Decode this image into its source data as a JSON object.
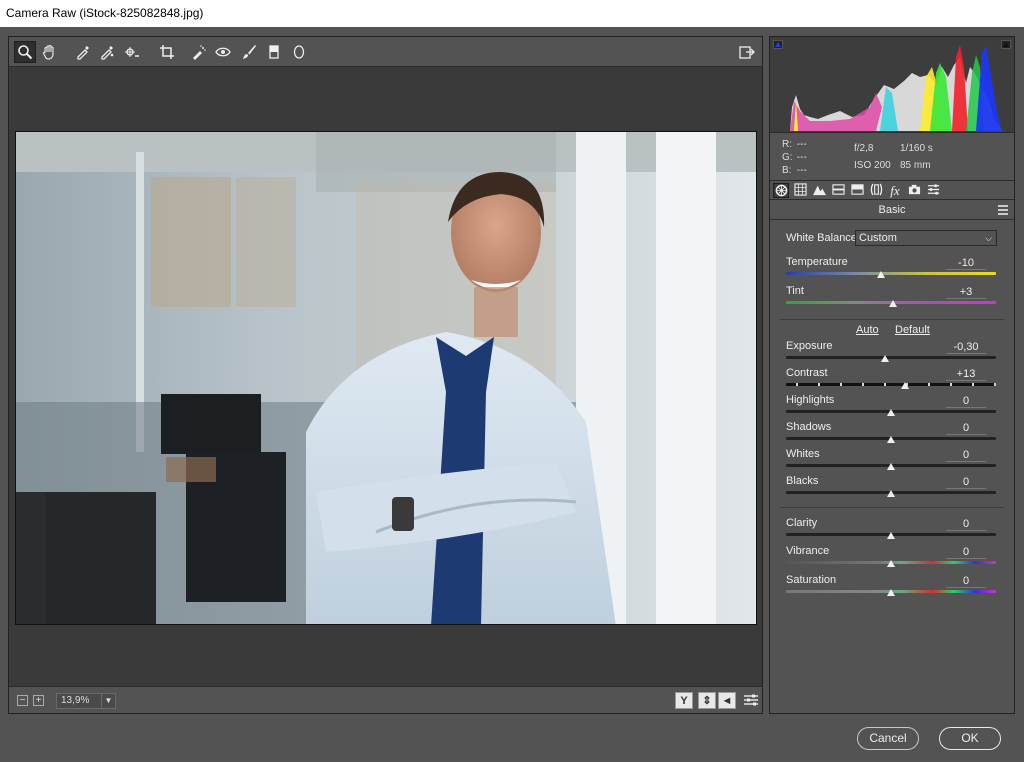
{
  "window": {
    "title": "Camera Raw (iStock-825082848.jpg)"
  },
  "toolbar": {
    "tools": [
      {
        "name": "zoom-tool",
        "glyph": "🔍"
      },
      {
        "name": "hand-tool",
        "glyph": "✋"
      },
      {
        "name": "white-balance-tool",
        "glyph": "💉"
      },
      {
        "name": "color-sampler-tool",
        "glyph": "✎"
      },
      {
        "name": "targeted-adjustment-tool",
        "glyph": "◎"
      },
      {
        "name": "crop-tool",
        "glyph": "⌗"
      },
      {
        "name": "spot-removal-tool",
        "glyph": "✐"
      },
      {
        "name": "red-eye-tool",
        "glyph": "👁"
      },
      {
        "name": "adjustment-brush-tool",
        "glyph": "🖌"
      },
      {
        "name": "graduated-filter-tool",
        "glyph": "▮"
      },
      {
        "name": "radial-filter-tool",
        "glyph": "◯"
      }
    ]
  },
  "zoom": {
    "value": "13,9%",
    "minus": "−",
    "plus": "+"
  },
  "bottom_icons": {
    "y": "Y",
    "compare": "⇕",
    "toggle": "◄"
  },
  "info": {
    "r_label": "R:",
    "r": "---",
    "g_label": "G:",
    "g": "---",
    "b_label": "B:",
    "b": "---",
    "aperture": "f/2,8",
    "shutter": "1/160 s",
    "iso": "ISO 200",
    "focal": "85 mm"
  },
  "panel": {
    "title": "Basic",
    "white_balance_label": "White Balance:",
    "white_balance_value": "Custom",
    "auto": "Auto",
    "default": "Default",
    "sliders": [
      {
        "key": "temperature",
        "label": "Temperature",
        "value": "-10",
        "pos": 0.45
      },
      {
        "key": "tint",
        "label": "Tint",
        "value": "+3",
        "pos": 0.51
      },
      {
        "key": "exposure",
        "label": "Exposure",
        "value": "-0,30",
        "pos": 0.47
      },
      {
        "key": "contrast",
        "label": "Contrast",
        "value": "+13",
        "pos": 0.565
      },
      {
        "key": "highlights",
        "label": "Highlights",
        "value": "0",
        "pos": 0.5
      },
      {
        "key": "shadows",
        "label": "Shadows",
        "value": "0",
        "pos": 0.5
      },
      {
        "key": "whites",
        "label": "Whites",
        "value": "0",
        "pos": 0.5
      },
      {
        "key": "blacks",
        "label": "Blacks",
        "value": "0",
        "pos": 0.5
      },
      {
        "key": "clarity",
        "label": "Clarity",
        "value": "0",
        "pos": 0.5
      },
      {
        "key": "vibrance",
        "label": "Vibrance",
        "value": "0",
        "pos": 0.5
      },
      {
        "key": "saturation",
        "label": "Saturation",
        "value": "0",
        "pos": 0.5
      }
    ]
  },
  "footer": {
    "cancel": "Cancel",
    "ok": "OK"
  },
  "colors": {
    "panel": "#535353",
    "canvas": "#3a3a3a",
    "histogram_bg": "#3d3d3d"
  }
}
